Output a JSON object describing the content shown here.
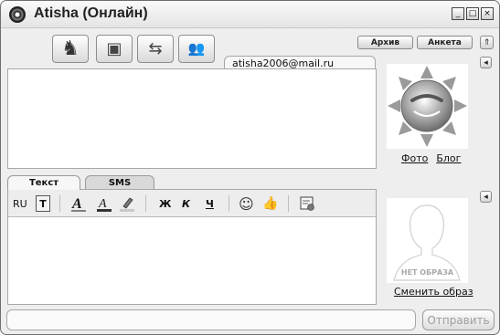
{
  "window": {
    "title": "Atisha (Онлайн)",
    "icons": {
      "app": "icq-flower-icon",
      "minimize": "minimize-icon",
      "maximize": "maximize-icon",
      "close": "close-icon"
    },
    "controls": {
      "minimize": "_",
      "maximize": "□",
      "close": "×"
    }
  },
  "toolbar": {
    "buttons": [
      {
        "icon": "history-icon",
        "glyph": "◔"
      },
      {
        "icon": "chess-knight-icon",
        "glyph": "♞"
      },
      {
        "icon": "floppy-disk-icon",
        "glyph": "▣"
      },
      {
        "icon": "file-transfer-icon",
        "glyph": "⇆"
      },
      {
        "icon": "add-contacts-icon",
        "glyph": "👥"
      }
    ],
    "archive_label": "Архив",
    "profile_label": "Анкета",
    "pin_glyph": "⇑"
  },
  "contact": {
    "email": "atisha2006@mail.ru",
    "collapse_glyph": "◂",
    "photo_link": "Фото",
    "blog_link": "Блог"
  },
  "compose": {
    "tabs": [
      {
        "label": "Текст"
      },
      {
        "label": "SMS"
      }
    ],
    "format": {
      "lang": "RU",
      "translit_glyph": "T",
      "bold": "Ж",
      "italic": "К",
      "underline": "Ч",
      "smiley_glyph": "☺",
      "thumb_glyph": "👍"
    }
  },
  "self": {
    "no_image_label": "НЕТ ОБРАЗА",
    "change_label": "Сменить образ",
    "collapse_glyph": "◂"
  },
  "footer": {
    "send_label": "Отправить"
  },
  "colors": {
    "window_bg": "#eeeeee",
    "border": "#a7a7a7",
    "disabled_text": "#9d9d9d"
  }
}
